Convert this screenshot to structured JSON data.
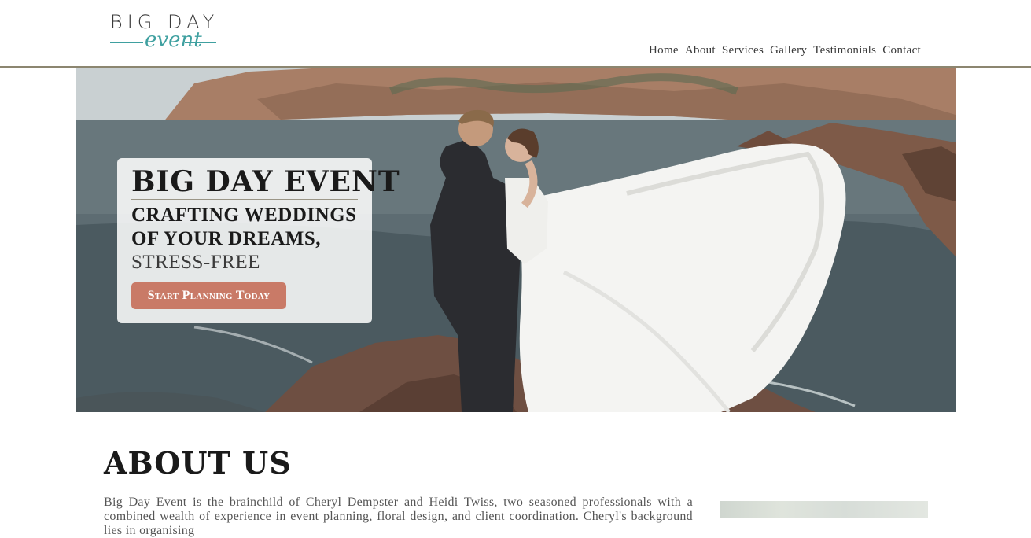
{
  "header": {
    "logo": {
      "top_text": "BIG DAY",
      "script_text": "event",
      "accent_color": "#3fa0a0"
    },
    "nav": [
      {
        "label": "Home"
      },
      {
        "label": "About"
      },
      {
        "label": "Services"
      },
      {
        "label": "Gallery"
      },
      {
        "label": "Testimonials"
      },
      {
        "label": "Contact"
      }
    ]
  },
  "hero": {
    "title": "BIG DAY EVENT",
    "subtitle_line1": "CRAFTING WEDDINGS",
    "subtitle_line2": "OF YOUR DREAMS,",
    "subtitle_line3": "STRESS-FREE",
    "cta_label": "Start Planning Today",
    "cta_color": "#c97a67",
    "image": "wedding-couple-photo"
  },
  "about": {
    "title": "ABOUT US",
    "text": "Big Day Event is the brainchild of Cheryl Dempster and Heidi Twiss, two seasoned professionals with a combined wealth of experience in event planning, floral design, and client coordination. Cheryl's background lies in organising"
  }
}
